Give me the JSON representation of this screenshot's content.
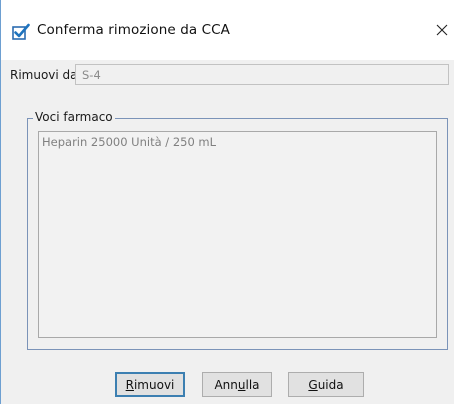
{
  "window": {
    "title": "Conferma rimozione da CCA",
    "close_glyph": "✕"
  },
  "form": {
    "remove_from_label": "Rimuovi da:",
    "remove_from_value": "S-4"
  },
  "drug_items": {
    "legend": "Voci farmaco",
    "items": [
      "Heparin 25000 Unità / 250 mL"
    ]
  },
  "buttons": {
    "remove": {
      "pre": "",
      "mnemonic": "R",
      "post": "imuovi"
    },
    "cancel": {
      "pre": "Ann",
      "mnemonic": "u",
      "post": "lla"
    },
    "help": {
      "pre": "",
      "mnemonic": "G",
      "post": "uida"
    }
  },
  "colors": {
    "accent": "#1e73be",
    "window_bg": "#f0f0f0",
    "groupbox_border": "#7b93b8"
  },
  "icons": {
    "app": "checkbox-checked-icon",
    "close": "close-icon"
  }
}
